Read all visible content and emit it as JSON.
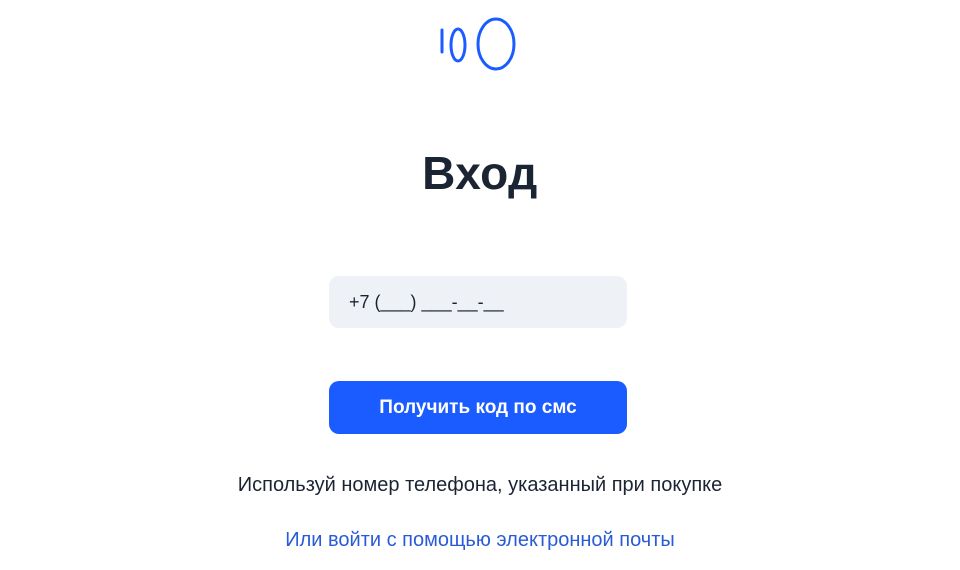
{
  "brand": {
    "logo_icon": "brand-logo-icon",
    "accent_color": "#1a5cff"
  },
  "login": {
    "title": "Вход",
    "phone_placeholder": "+7 (___) ___-__-__",
    "submit_label": "Получить код по смс",
    "hint": "Используй номер телефона, указанный при покупке",
    "email_link": "Или войти с помощью электронной почты"
  }
}
